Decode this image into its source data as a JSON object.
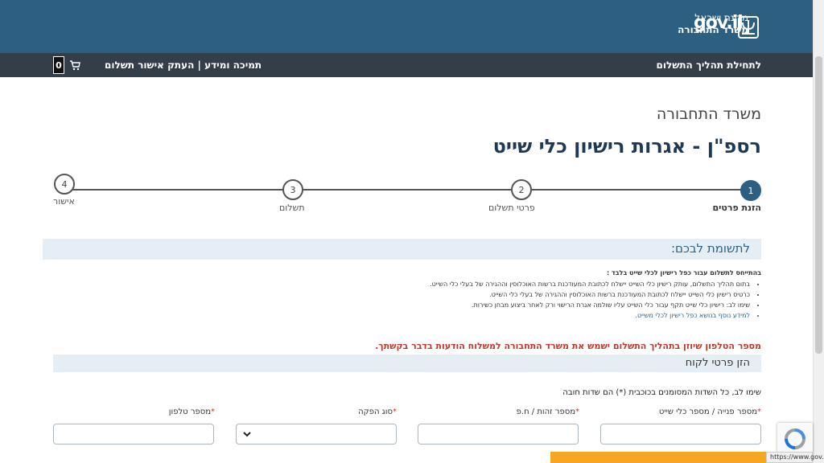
{
  "header": {
    "state_name": "מדינת ישראל",
    "ministry_name": "משרד התחבורה",
    "logo_text": "gov.il"
  },
  "nav": {
    "start_link": "לתחילת תהליך התשלום",
    "support_links": "תמיכה ומידע | העתק אישור תשלום",
    "cart_count": "0"
  },
  "page": {
    "ministry": "משרד התחבורה",
    "title": "רספ\"ן - אגרות רישיון כלי שייט"
  },
  "steps": [
    {
      "number": "1",
      "label": "הזנת פרטים",
      "active": true
    },
    {
      "number": "2",
      "label": "פרטי תשלום",
      "active": false
    },
    {
      "number": "3",
      "label": "תשלום",
      "active": false
    },
    {
      "number": "4",
      "label": "אישור",
      "active": false
    }
  ],
  "attention": {
    "title": "לתשומת לבכם:",
    "ref_line": "בהתייחס לתשלום עבור כפל רישיון לכלי שייט בלבד :",
    "bullets": [
      "בתום תהליך התשלום, עותק רישיון כלי השייט יישלח לכתובת המעודכנת ברשות האוכלוסין וההגירה של בעלי כלי השייט.",
      "כרטיס רישיון כלי השייט יישלח לכתובת המעודכנת ברשות האוכלוסין וההגירה של בעלי כלי השייט.",
      "שימו לב: רישיון כלי שייט תקף עבור כלי השייט עליו שולמה אגרת הרישוי ורק לאחר ביצוע מבחן כשירות.",
      "למידע נוסף בנושא כפל רישיון לכלי משייט."
    ]
  },
  "warning": "מספר הטלפון שיוזן בתהליך התשלום ישמש את משרד התחבורה למשלוח הודעות בדבר בקשתך.",
  "customer": {
    "section_title": "הזן פרטי לקוח",
    "required_note": "שימו לב, כל השדות המסומנים בכוכבית (*) הם שדות חובה",
    "fields": {
      "hull_number": "מספר פנייה / מספר כלי שייט",
      "id_number": "מספר זהות / ח.פ",
      "issue_type": "סוג הפקה",
      "phone": "מספר טלפון"
    },
    "required_mark": "*"
  },
  "status_bar": {
    "url": "https://www.gov.il"
  },
  "colors": {
    "header_bg": "#2d5f83",
    "nav_bg": "#333e49",
    "warning": "#c0392b",
    "section_bg": "#e6eef5"
  }
}
